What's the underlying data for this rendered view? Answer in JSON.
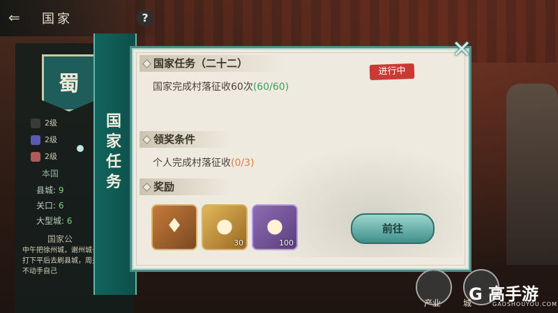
{
  "header": {
    "back_icon": "back-arrow-icon",
    "title": "国家",
    "help_label": "?"
  },
  "left_panel": {
    "banner_text": "蜀",
    "levels": [
      {
        "icon": "exclaim-icon",
        "label": "2级"
      },
      {
        "icon": "shield-icon",
        "label": "2级"
      },
      {
        "icon": "shield-red-icon",
        "label": "2级"
      }
    ],
    "stats_title": "本国",
    "stats": [
      {
        "label": "县城:",
        "value": "9"
      },
      {
        "label": "关口:",
        "value": "6"
      },
      {
        "label": "大型城:",
        "value": "6"
      }
    ],
    "news_title": "国家公",
    "news_text": "中午把徐州城，谢州城一起拿了，晚打下平后去刷县城，周关卡，你们也不动手自己"
  },
  "ribbon": {
    "label": "国家任务"
  },
  "card": {
    "close_icon": "close-icon",
    "task_title": "国家任务（二十二）",
    "status": "进行中",
    "task_desc": "国家完成村落征收60次",
    "task_progress": "(60/60)",
    "condition_title": "领奖条件",
    "condition_desc": "个人完成村落征收",
    "condition_progress": "(0/3)",
    "reward_title": "奖励",
    "rewards": [
      {
        "icon": "token-icon",
        "count": ""
      },
      {
        "icon": "gold-ingot-icon",
        "count": "30"
      },
      {
        "icon": "medal-icon",
        "count": "100"
      }
    ],
    "go_label": "前往"
  },
  "bottom": {
    "industry_label": "产业",
    "city_label": "城",
    "logo": "G 高手游",
    "logo_sub": "GAOSHOUYOU.COM"
  }
}
